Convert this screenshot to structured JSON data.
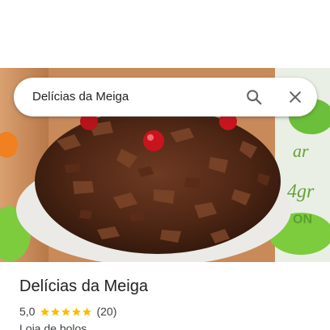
{
  "search": {
    "query": "Delícias da Meiga"
  },
  "place": {
    "name": "Delícias da Meiga",
    "rating": "5,0",
    "rating_value": 5.0,
    "stars_filled": 5,
    "review_count": "(20)",
    "category": "Loja de bolos"
  },
  "colors": {
    "star": "#fbbc04",
    "text_primary": "#202124",
    "text_secondary": "#3c4043",
    "icon": "#5f6368"
  },
  "icons": {
    "search": "search-icon",
    "close": "close-icon",
    "star": "star-icon"
  }
}
